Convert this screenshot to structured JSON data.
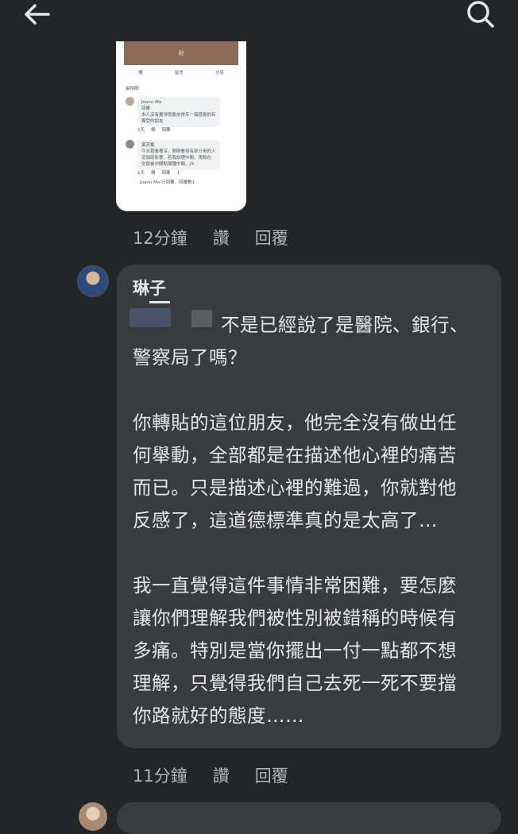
{
  "header": {
    "back_icon": "arrow-left-icon",
    "search_icon": "search-icon"
  },
  "thumbnail": {
    "banner_text": "財",
    "like_label": "讚",
    "comment_label": "留言",
    "share_label": "分享",
    "filter_label": "最相關",
    "comment1": {
      "name": "Joann Ma",
      "line1": "回覆",
      "line2": "本人沒有覺得厚臉皮排斥一個感覺的有",
      "line3": "獨受的朋友",
      "time": "1天",
      "like": "讚",
      "reply": "回覆"
    },
    "comment2": {
      "name": "莫芳馨",
      "line1": "今天我看著沒，剛剛看到有部分用的入",
      "line2": "這個部影響，若我說理中間，現和在",
      "line3": "交談後中間點面種中間，[X",
      "time": "1天",
      "like": "讚",
      "reply": "回覆",
      "count": "1"
    },
    "footer": "Joann Ma 已回覆．回覆數1"
  },
  "meta1": {
    "time": "12分鐘",
    "like": "讚",
    "reply": "回覆"
  },
  "comment": {
    "author": "琳子",
    "para1": "不是已經說了是醫院、銀行、警察局了嗎？",
    "para2": "你轉貼的這位朋友，他完全沒有做出任何舉動，全部都是在描述他心裡的痛苦而已。只是描述心裡的難過，你就對他反感了，這道德標準真的是太高了…",
    "para3": "我一直覺得這件事情非常困難，要怎麼讓你們理解我們被性別被錯稱的時候有多痛。特別是當你擺出一付一點都不想理解，只覺得我們自己去死一死不要擋你路就好的態度……"
  },
  "meta2": {
    "time": "11分鐘",
    "like": "讚",
    "reply": "回覆"
  },
  "colors": {
    "background": "#242526",
    "bubble": "#3a3b3c",
    "text": "#e4e6eb",
    "muted": "#b0b3b8"
  }
}
